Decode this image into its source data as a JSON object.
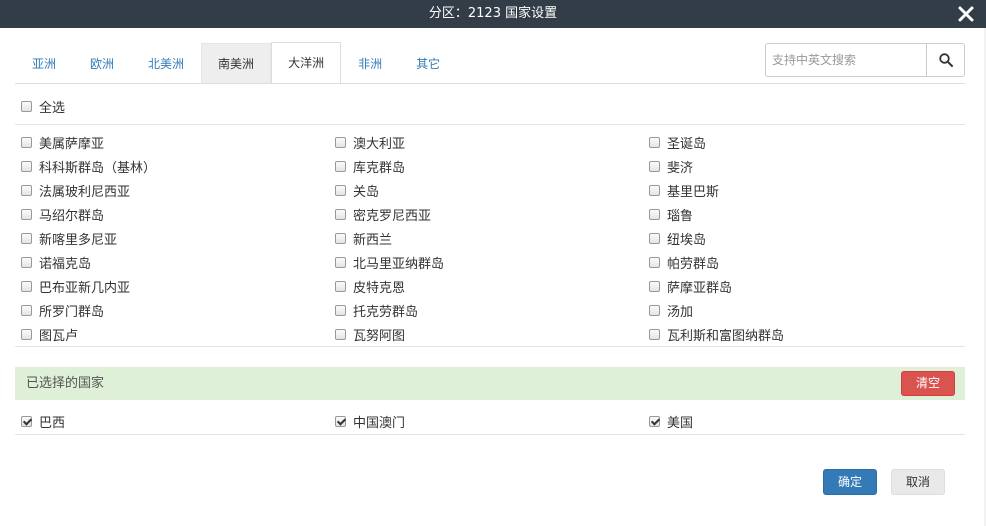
{
  "title": "分区：2123 国家设置",
  "tabs": [
    {
      "label": "亚洲"
    },
    {
      "label": "欧洲"
    },
    {
      "label": "北美洲"
    },
    {
      "label": "南美洲"
    },
    {
      "label": "大洋洲"
    },
    {
      "label": "非洲"
    },
    {
      "label": "其它"
    }
  ],
  "active_tab": "大洋洲",
  "search": {
    "placeholder": "支持中英文搜索",
    "value": ""
  },
  "select_all_label": "全选",
  "countries": [
    {
      "label": "美属萨摩亚",
      "checked": false
    },
    {
      "label": "澳大利亚",
      "checked": false
    },
    {
      "label": "圣诞岛",
      "checked": false
    },
    {
      "label": "科科斯群岛（基林）",
      "checked": false
    },
    {
      "label": "库克群岛",
      "checked": false
    },
    {
      "label": "斐济",
      "checked": false
    },
    {
      "label": "法属玻利尼西亚",
      "checked": false
    },
    {
      "label": "关岛",
      "checked": false
    },
    {
      "label": "基里巴斯",
      "checked": false
    },
    {
      "label": "马绍尔群岛",
      "checked": false
    },
    {
      "label": "密克罗尼西亚",
      "checked": false
    },
    {
      "label": "瑙鲁",
      "checked": false
    },
    {
      "label": "新喀里多尼亚",
      "checked": false
    },
    {
      "label": "新西兰",
      "checked": false
    },
    {
      "label": "纽埃岛",
      "checked": false
    },
    {
      "label": "诺福克岛",
      "checked": false
    },
    {
      "label": "北马里亚纳群岛",
      "checked": false
    },
    {
      "label": "帕劳群岛",
      "checked": false
    },
    {
      "label": "巴布亚新几内亚",
      "checked": false
    },
    {
      "label": "皮特克恩",
      "checked": false
    },
    {
      "label": "萨摩亚群岛",
      "checked": false
    },
    {
      "label": "所罗门群岛",
      "checked": false
    },
    {
      "label": "托克劳群岛",
      "checked": false
    },
    {
      "label": "汤加",
      "checked": false
    },
    {
      "label": "图瓦卢",
      "checked": false
    },
    {
      "label": "瓦努阿图",
      "checked": false
    },
    {
      "label": "瓦利斯和富图纳群岛",
      "checked": false
    }
  ],
  "selected_section": {
    "title": "已选择的国家",
    "clear_label": "清空",
    "items": [
      {
        "label": "巴西",
        "checked": true
      },
      {
        "label": "中国澳门",
        "checked": true
      },
      {
        "label": "美国",
        "checked": true
      }
    ]
  },
  "footer": {
    "ok_label": "确定",
    "cancel_label": "取消"
  },
  "colors": {
    "titlebar": "#333d47",
    "primary": "#337ab7",
    "danger": "#d9534f",
    "selected_bg": "#dff0d8"
  }
}
